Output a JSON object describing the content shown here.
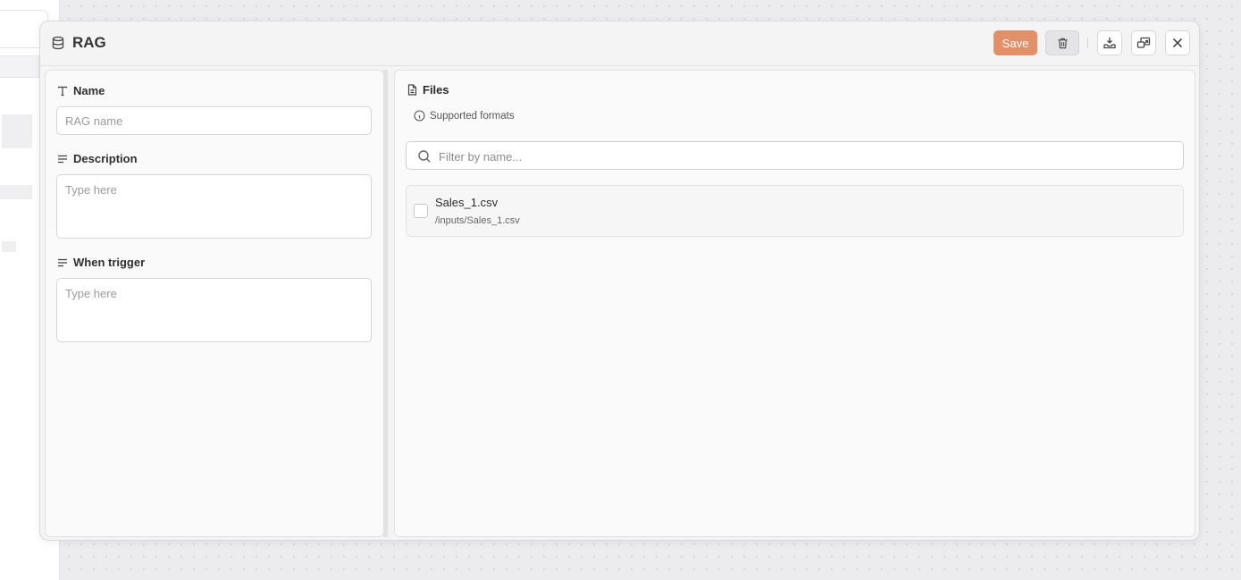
{
  "modal": {
    "title": "RAG",
    "icon": "database-icon",
    "actions": {
      "save_label": "Save",
      "delete_icon": "trash-icon",
      "download_icon": "download-icon",
      "fullscreen_icon": "external-window-icon",
      "close_icon": "close-icon"
    }
  },
  "left_panel": {
    "name": {
      "label": "Name",
      "placeholder": "RAG name",
      "value": ""
    },
    "description": {
      "label": "Description",
      "placeholder": "Type here",
      "value": ""
    },
    "when_trigger": {
      "label": "When trigger",
      "placeholder": "Type here",
      "value": ""
    }
  },
  "right_panel": {
    "files_label": "Files",
    "supported_formats": "Supported formats",
    "filter_placeholder": "Filter by name...",
    "files": [
      {
        "name": "Sales_1.csv",
        "path": "/inputs/Sales_1.csv",
        "checked": false
      }
    ]
  },
  "colors": {
    "accent": "#e2906a",
    "background": "#ececee",
    "panel": "#fafafa"
  }
}
